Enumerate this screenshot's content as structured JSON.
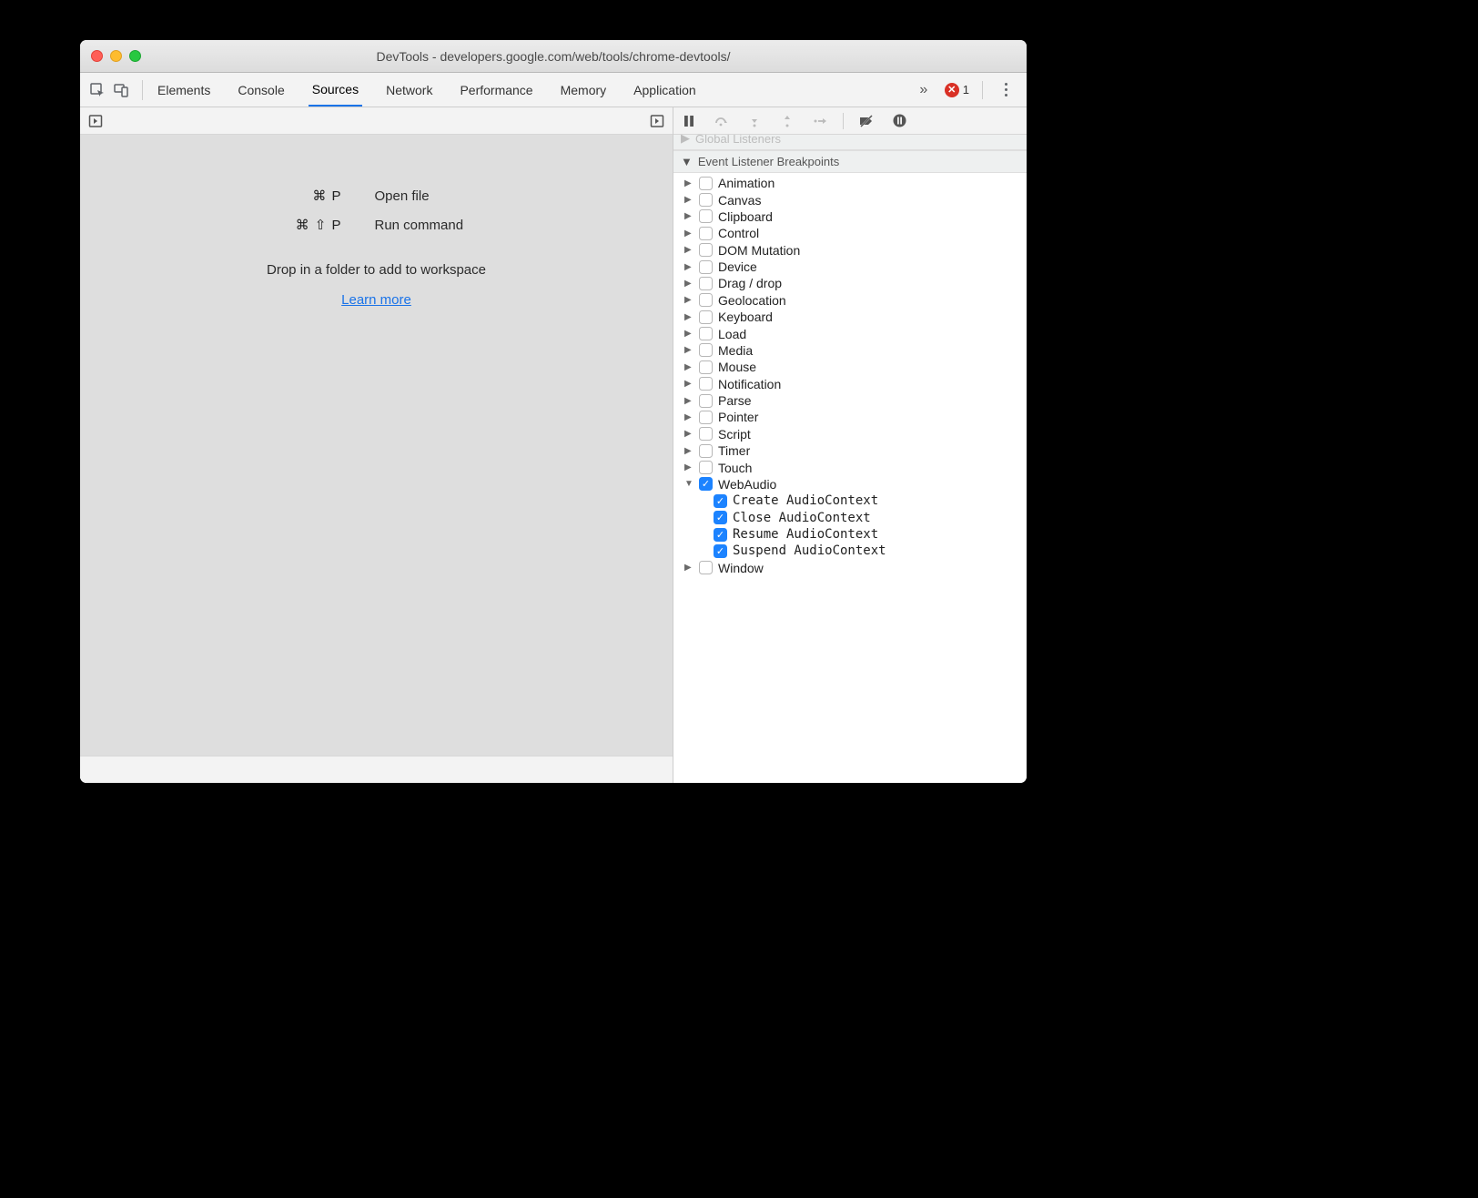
{
  "window": {
    "title": "DevTools - developers.google.com/web/tools/chrome-devtools/"
  },
  "tabs": {
    "items": [
      "Elements",
      "Console",
      "Sources",
      "Network",
      "Performance",
      "Memory",
      "Application"
    ],
    "active": "Sources",
    "error_count": "1"
  },
  "sources_pane": {
    "open_file_keys": "⌘ P",
    "open_file_label": "Open file",
    "run_command_keys": "⌘ ⇧ P",
    "run_command_label": "Run command",
    "drop_text": "Drop in a folder to add to workspace",
    "learn_more": "Learn more"
  },
  "right": {
    "partial_section": "Global Listeners",
    "section_title": "Event Listener Breakpoints",
    "categories": [
      {
        "label": "Animation",
        "expanded": false,
        "checked": false,
        "children": []
      },
      {
        "label": "Canvas",
        "expanded": false,
        "checked": false,
        "children": []
      },
      {
        "label": "Clipboard",
        "expanded": false,
        "checked": false,
        "children": []
      },
      {
        "label": "Control",
        "expanded": false,
        "checked": false,
        "children": []
      },
      {
        "label": "DOM Mutation",
        "expanded": false,
        "checked": false,
        "children": []
      },
      {
        "label": "Device",
        "expanded": false,
        "checked": false,
        "children": []
      },
      {
        "label": "Drag / drop",
        "expanded": false,
        "checked": false,
        "children": []
      },
      {
        "label": "Geolocation",
        "expanded": false,
        "checked": false,
        "children": []
      },
      {
        "label": "Keyboard",
        "expanded": false,
        "checked": false,
        "children": []
      },
      {
        "label": "Load",
        "expanded": false,
        "checked": false,
        "children": []
      },
      {
        "label": "Media",
        "expanded": false,
        "checked": false,
        "children": []
      },
      {
        "label": "Mouse",
        "expanded": false,
        "checked": false,
        "children": []
      },
      {
        "label": "Notification",
        "expanded": false,
        "checked": false,
        "children": []
      },
      {
        "label": "Parse",
        "expanded": false,
        "checked": false,
        "children": []
      },
      {
        "label": "Pointer",
        "expanded": false,
        "checked": false,
        "children": []
      },
      {
        "label": "Script",
        "expanded": false,
        "checked": false,
        "children": []
      },
      {
        "label": "Timer",
        "expanded": false,
        "checked": false,
        "children": []
      },
      {
        "label": "Touch",
        "expanded": false,
        "checked": false,
        "children": []
      },
      {
        "label": "WebAudio",
        "expanded": true,
        "checked": true,
        "children": [
          {
            "label": "Create AudioContext",
            "checked": true
          },
          {
            "label": "Close AudioContext",
            "checked": true
          },
          {
            "label": "Resume AudioContext",
            "checked": true
          },
          {
            "label": "Suspend AudioContext",
            "checked": true
          }
        ]
      },
      {
        "label": "Window",
        "expanded": false,
        "checked": false,
        "children": []
      }
    ]
  }
}
